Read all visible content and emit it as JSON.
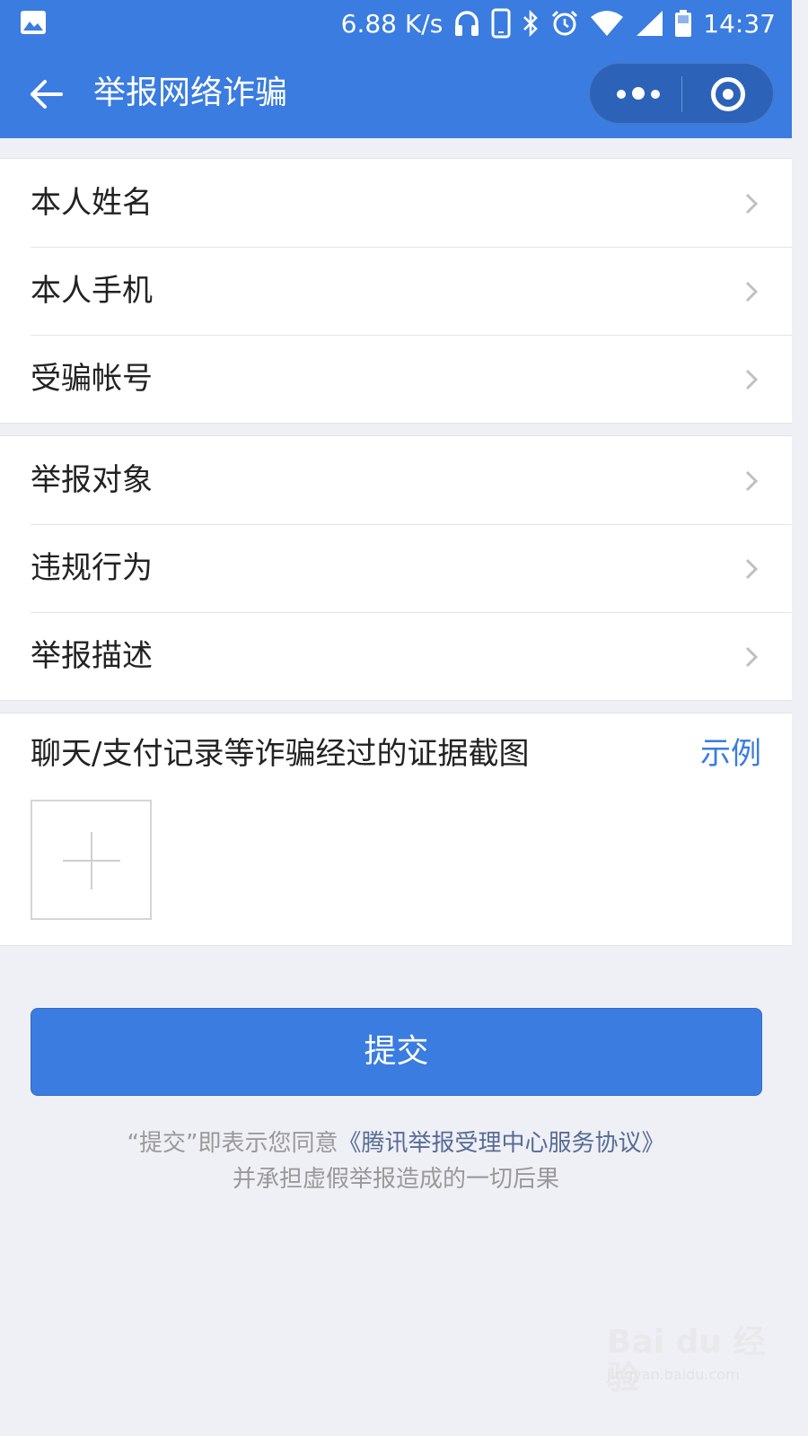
{
  "status_bar": {
    "network_speed": "6.88 K/s",
    "time": "14:37",
    "icons": [
      "gallery-icon",
      "headphones-icon",
      "phone-icon",
      "bluetooth-icon",
      "alarm-icon",
      "wifi-icon",
      "signal-icon",
      "battery-icon"
    ]
  },
  "nav": {
    "title": "举报网络诈骗",
    "back_icon": "back-arrow-icon",
    "more_icon": "more-dots-icon",
    "close_icon": "target-icon"
  },
  "colors": {
    "primary": "#3a7ce0",
    "background": "#eff0f5",
    "link": "#576b95"
  },
  "group1": {
    "items": [
      {
        "label": "本人姓名"
      },
      {
        "label": "本人手机"
      },
      {
        "label": "受骗帐号"
      }
    ]
  },
  "group2": {
    "items": [
      {
        "label": "举报对象"
      },
      {
        "label": "违规行为"
      },
      {
        "label": "举报描述"
      }
    ]
  },
  "evidence": {
    "title": "聊天/支付记录等诈骗经过的证据截图",
    "example_label": "示例",
    "upload_icon": "plus-icon"
  },
  "submit": {
    "label": "提交"
  },
  "agreement": {
    "prefix": "“提交”即表示您同意",
    "link": "《腾讯举报受理中心服务协议》",
    "line2": "并承担虚假举报造成的一切后果"
  },
  "watermark": {
    "logo": "Bai du 经验",
    "url": "jingyan.baidu.com"
  }
}
